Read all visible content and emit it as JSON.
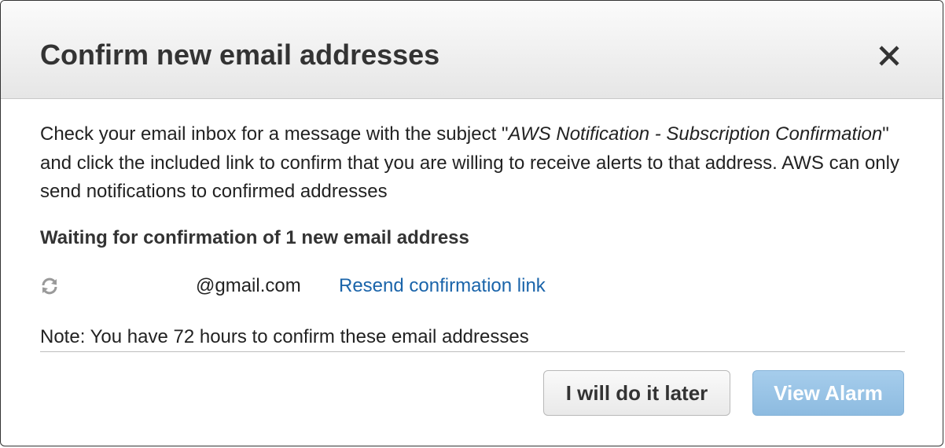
{
  "dialog": {
    "title": "Confirm new email addresses",
    "close_icon": "close-icon",
    "message": {
      "part1": "Check your email inbox for a message with the subject \"",
      "subject": "AWS Notification - Subscription Confirmation",
      "part2": "\" and click the included link to confirm that you are willing to receive alerts to that address. AWS can only send notifications to confirmed addresses"
    },
    "waiting_heading": "Waiting for confirmation of 1 new email address",
    "pending": {
      "status_icon": "refresh-icon",
      "email": "@gmail.com",
      "resend_link": "Resend confirmation link"
    },
    "note": "Note: You have 72 hours to confirm these email addresses",
    "buttons": {
      "later": "I will do it later",
      "view_alarm": "View Alarm"
    }
  },
  "colors": {
    "link": "#1a64aa",
    "primary_button": "#98c4e6",
    "title_text": "#333333"
  }
}
